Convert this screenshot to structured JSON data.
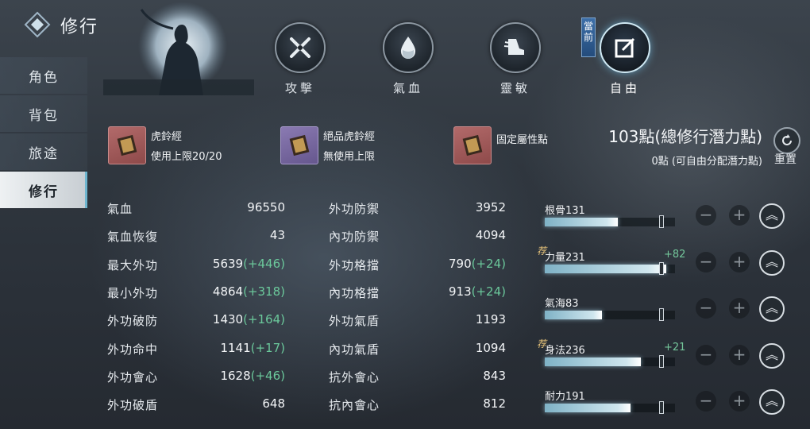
{
  "header": {
    "title": "修行",
    "logo_icon": "diamond-emblem-icon"
  },
  "sidebar": {
    "items": [
      {
        "label": "角色",
        "active": false
      },
      {
        "label": "背包",
        "active": false
      },
      {
        "label": "旅途",
        "active": false
      },
      {
        "label": "修行",
        "active": true
      }
    ]
  },
  "tabs": [
    {
      "label": "攻擊",
      "icon": "crossed-swords-icon"
    },
    {
      "label": "氣血",
      "icon": "blood-drop-icon"
    },
    {
      "label": "靈敏",
      "icon": "winged-boot-icon"
    },
    {
      "label": "自由",
      "icon": "edit-icon",
      "active": true,
      "current_tag": "當前"
    }
  ],
  "items": [
    {
      "name": "虎鈴經",
      "sub": "使用上限20/20",
      "rarity": "red",
      "icon": "scroll-book-icon"
    },
    {
      "name": "絕品虎鈴經",
      "sub": "無使用上限",
      "rarity": "purple",
      "icon": "scroll-book-icon"
    },
    {
      "name": "固定屬性點",
      "sub": "",
      "rarity": "red",
      "icon": "scroll-book-icon"
    }
  ],
  "points": {
    "total_text": "103點(總修行潛力點)",
    "free_text": "0點 (可自由分配潛力點)",
    "reset_label": "重置"
  },
  "stats_left": [
    {
      "name": "氣血",
      "value": "96550",
      "bonus": ""
    },
    {
      "name": "氣血恢復",
      "value": "43",
      "bonus": ""
    },
    {
      "name": "最大外功",
      "value": "5639",
      "bonus": "(+446)"
    },
    {
      "name": "最小外功",
      "value": "4864",
      "bonus": "(+318)"
    },
    {
      "name": "外功破防",
      "value": "1430",
      "bonus": "(+164)"
    },
    {
      "name": "外功命中",
      "value": "1141",
      "bonus": "(+17)"
    },
    {
      "name": "外功會心",
      "value": "1628",
      "bonus": "(+46)"
    },
    {
      "name": "外功破盾",
      "value": "648",
      "bonus": ""
    }
  ],
  "stats_right": [
    {
      "name": "外功防禦",
      "value": "3952",
      "bonus": ""
    },
    {
      "name": "內功防禦",
      "value": "4094",
      "bonus": ""
    },
    {
      "name": "外功格擋",
      "value": "790",
      "bonus": "(+24)"
    },
    {
      "name": "內功格擋",
      "value": "913",
      "bonus": "(+24)"
    },
    {
      "name": "外功氣盾",
      "value": "1193",
      "bonus": ""
    },
    {
      "name": "內功氣盾",
      "value": "1094",
      "bonus": ""
    },
    {
      "name": "抗外會心",
      "value": "843",
      "bonus": ""
    },
    {
      "name": "抗內會心",
      "value": "812",
      "bonus": ""
    }
  ],
  "attributes": [
    {
      "label": "根骨131",
      "bonus": "",
      "fill": 0.56,
      "recommended": false
    },
    {
      "label": "力量231",
      "bonus": "+82",
      "fill": 0.93,
      "recommended": true
    },
    {
      "label": "氣海83",
      "bonus": "",
      "fill": 0.44,
      "recommended": false
    },
    {
      "label": "身法236",
      "bonus": "+21",
      "fill": 0.74,
      "recommended": true
    },
    {
      "label": "耐力191",
      "bonus": "",
      "fill": 0.66,
      "recommended": false
    }
  ],
  "attribute_buttons": {
    "minus": "−",
    "plus": "+",
    "max": "︽"
  },
  "recommend_badge": "荐",
  "colors": {
    "bonus_green": "#6bc89b",
    "bar_fill": "#cfe6ee",
    "active_tab_glow": "#78c8f0"
  }
}
